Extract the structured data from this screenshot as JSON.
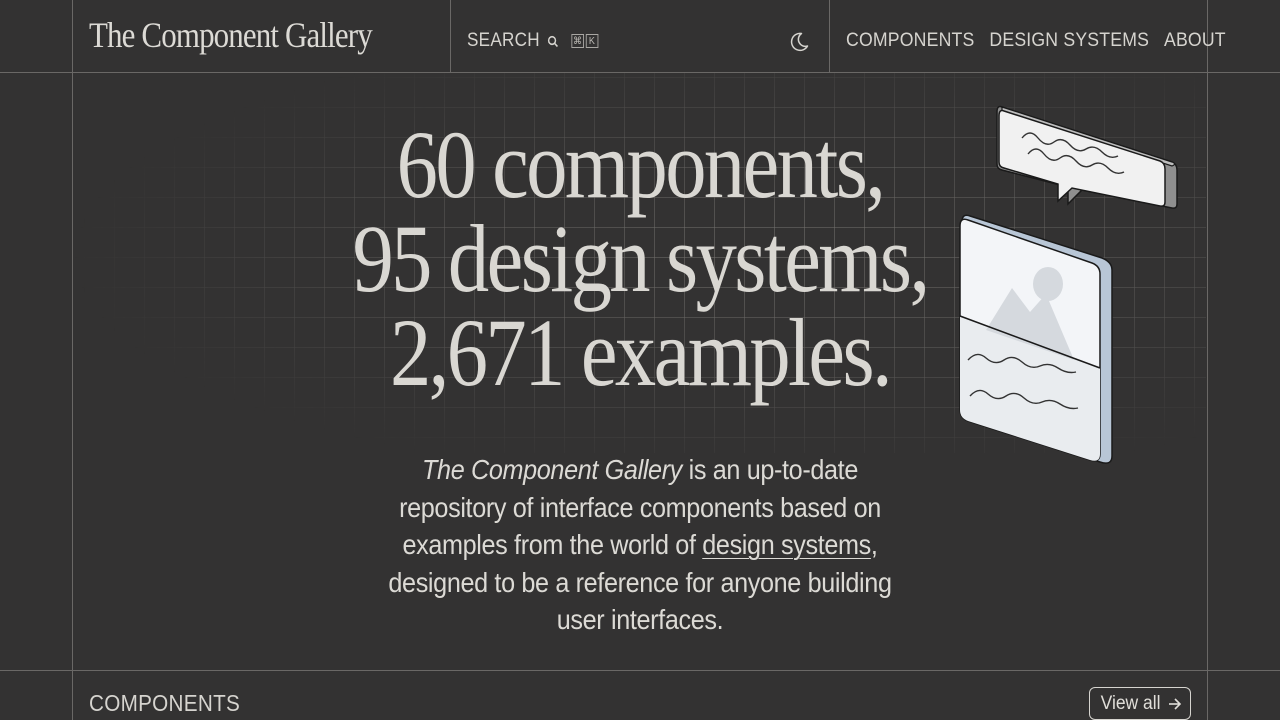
{
  "header": {
    "logo": "The Component Gallery",
    "search_label": "SEARCH",
    "shortcut_keys": [
      "⌘",
      "K"
    ],
    "theme_toggle_icon": "moon-icon",
    "nav": [
      {
        "label": "COMPONENTS"
      },
      {
        "label": "DESIGN SYSTEMS"
      },
      {
        "label": "ABOUT"
      }
    ]
  },
  "hero": {
    "line1": "60 components,",
    "line2": "95 design systems,",
    "line3": "2,671 examples.",
    "description": {
      "italic": "The Component Gallery",
      "part1": " is an up-to-date repository of interface components based on examples from the world of ",
      "link": "design systems",
      "part2": ", designed to be a reference for anyone building user interfaces."
    },
    "illustration_icons": [
      "speech-bubble-icon",
      "image-card-icon"
    ]
  },
  "components_section": {
    "title": "COMPONENTS",
    "view_all": "View all",
    "view_all_icon": "arrow-right-icon"
  },
  "colors": {
    "background": "#333232",
    "text": "#dcdad5",
    "rule": "#6a6866"
  }
}
